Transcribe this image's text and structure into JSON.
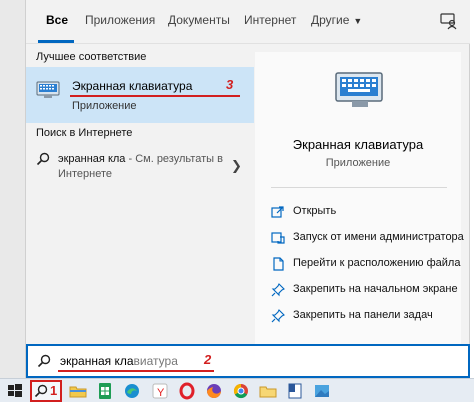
{
  "tabs": [
    {
      "label": "Все"
    },
    {
      "label": "Приложения"
    },
    {
      "label": "Документы"
    },
    {
      "label": "Интернет"
    },
    {
      "label": "Другие"
    }
  ],
  "best_match": {
    "heading": "Лучшее соответствие",
    "title": "Экранная клавиатура",
    "subtitle": "Приложение",
    "marker": "3"
  },
  "web": {
    "heading": "Поиск в Интернете",
    "query": "экранная кла",
    "suffix": " - См. результаты в Интернете"
  },
  "detail": {
    "title": "Экранная клавиатура",
    "subtitle": "Приложение",
    "actions": [
      {
        "label": "Открыть",
        "icon": "open-icon"
      },
      {
        "label": "Запуск от имени администратора",
        "icon": "admin-icon"
      },
      {
        "label": "Перейти к расположению файла",
        "icon": "file-location-icon"
      },
      {
        "label": "Закрепить на начальном экране",
        "icon": "pin-icon"
      },
      {
        "label": "Закрепить на панели задач",
        "icon": "pin-icon"
      }
    ]
  },
  "searchbox": {
    "typed": "экранная кла",
    "completion": "виатура",
    "marker": "2"
  },
  "taskbar": {
    "search_marker": "1",
    "apps": [
      "file-explorer-icon",
      "sheets-icon",
      "edge-icon",
      "yandex-icon",
      "opera-icon",
      "firefox-icon",
      "chrome-icon",
      "folder-icon",
      "document-icon",
      "photos-icon"
    ]
  },
  "colors": {
    "accent": "#0067c0",
    "highlight": "#cce4f7",
    "annotation": "#d21f1f"
  }
}
